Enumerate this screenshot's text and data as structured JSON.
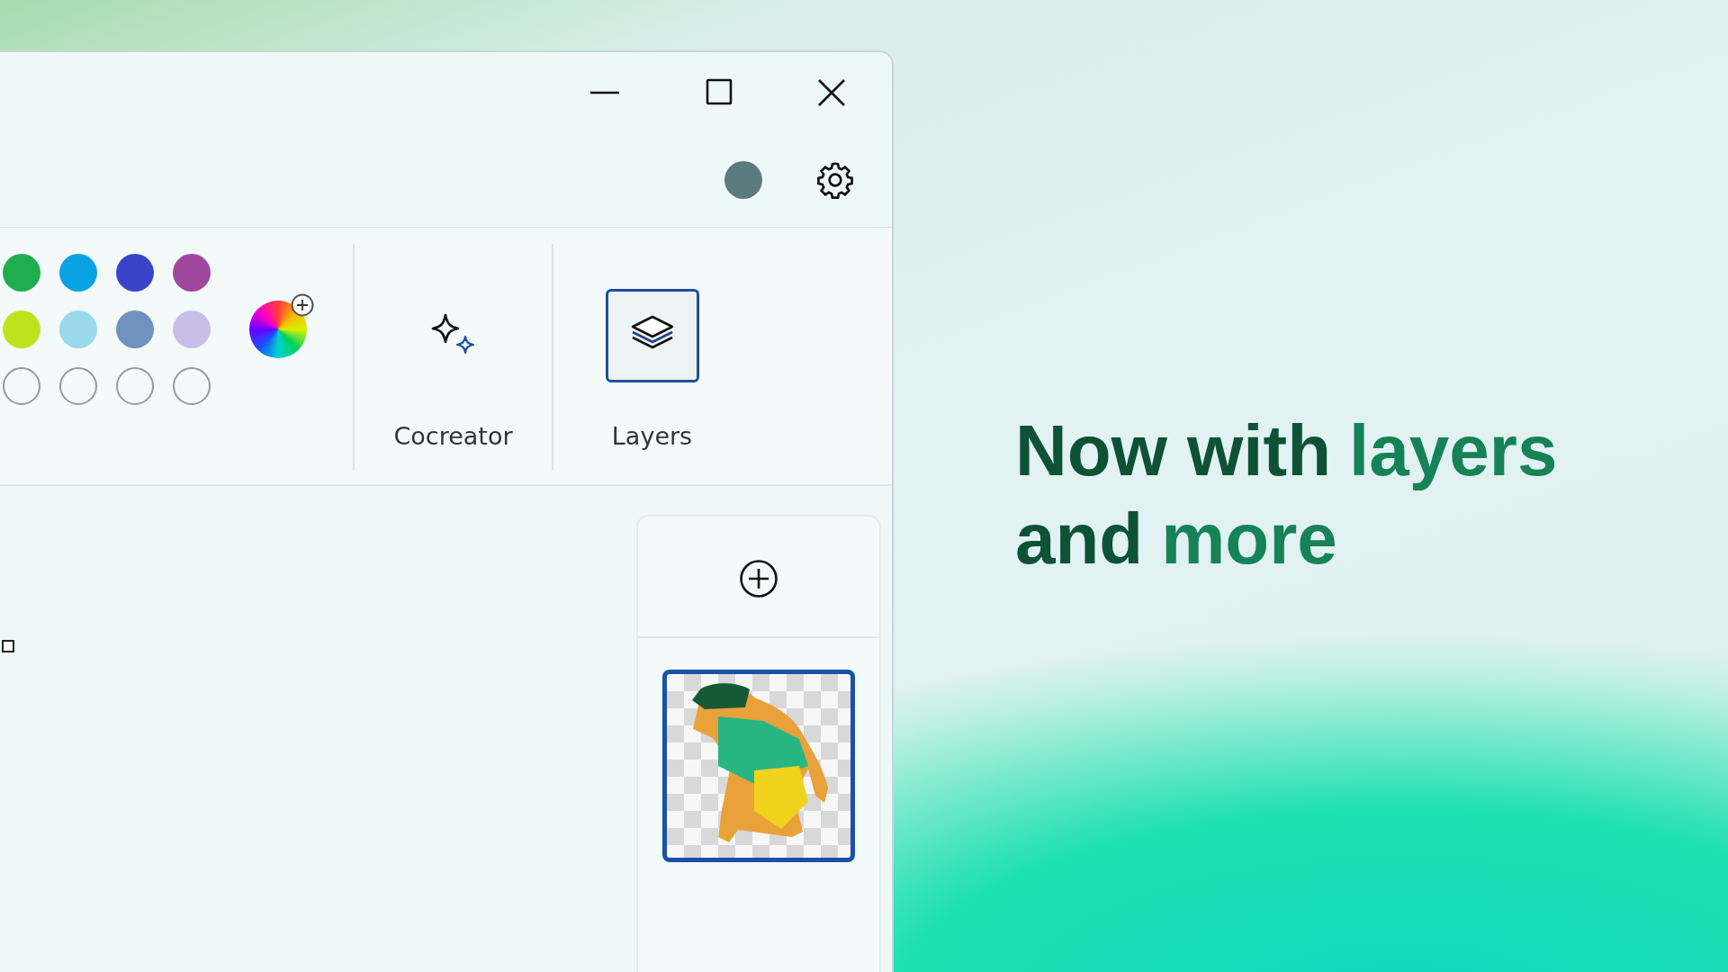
{
  "window": {
    "controls": [
      {
        "kind": "minimize"
      },
      {
        "kind": "maximize"
      },
      {
        "kind": "close"
      }
    ]
  },
  "account": {
    "kind": "avatar"
  },
  "palette": [
    {
      "kind": "filled",
      "color": "#1fae4f"
    },
    {
      "kind": "filled",
      "color": "#08a2e3"
    },
    {
      "kind": "filled",
      "color": "#3b44c8"
    },
    {
      "kind": "filled",
      "color": "#a0479d"
    },
    {
      "kind": "filled",
      "color": "#bde31d"
    },
    {
      "kind": "filled",
      "color": "#99d9ea"
    },
    {
      "kind": "filled",
      "color": "#7092be"
    },
    {
      "kind": "filled",
      "color": "#c8bfe7"
    },
    {
      "kind": "empty"
    },
    {
      "kind": "empty"
    },
    {
      "kind": "empty"
    },
    {
      "kind": "empty"
    }
  ],
  "tools": [
    {
      "kind": "cocreator",
      "label": "Cocreator",
      "selected": false
    },
    {
      "kind": "layers",
      "label": "Layers",
      "selected": true
    }
  ],
  "layers_panel": {
    "layers": [
      {
        "selected": true
      }
    ]
  },
  "headline": [
    [
      {
        "text": "Now with",
        "accent": false
      },
      {
        "text": "layers",
        "accent": true
      }
    ],
    [
      {
        "text": "and",
        "accent": false
      },
      {
        "text": "more",
        "accent": true
      }
    ]
  ]
}
